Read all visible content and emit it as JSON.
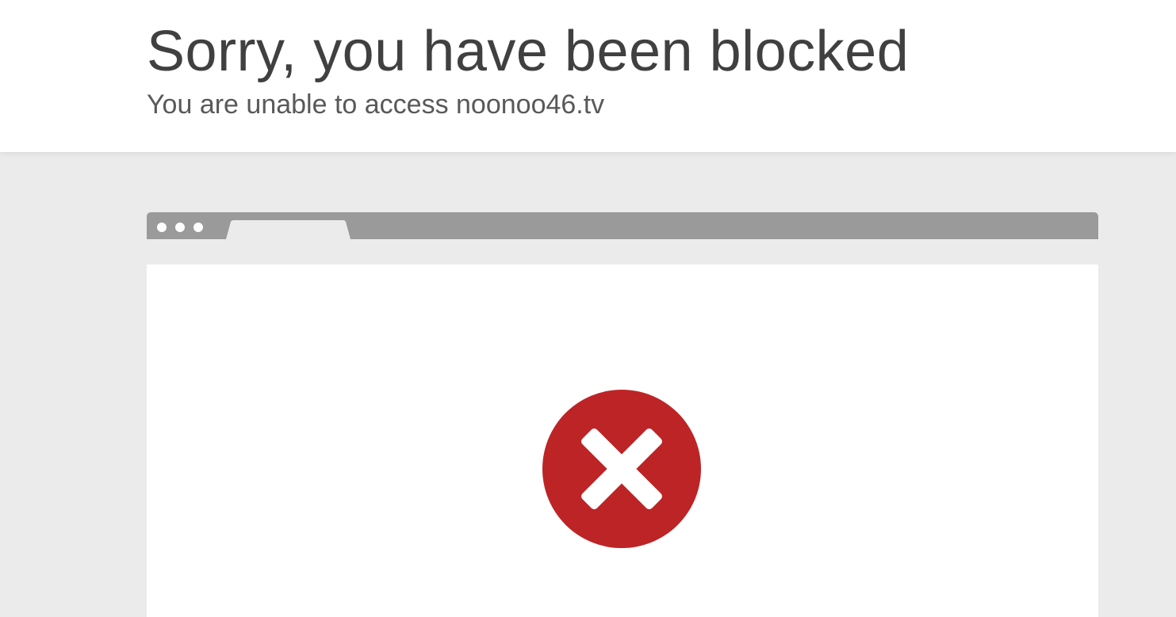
{
  "header": {
    "title": "Sorry, you have been blocked",
    "subtitle": "You are unable to access noonoo46.tv"
  },
  "browser_mock": {
    "dots": 3,
    "bar_color": "#9a9a9a",
    "tab_color": "#ebebeb"
  },
  "status_icon": {
    "name": "error-x-icon",
    "color": "#bd2426"
  },
  "colors": {
    "background": "#ebebeb",
    "header_bg": "#ffffff",
    "title_text": "#404040"
  }
}
